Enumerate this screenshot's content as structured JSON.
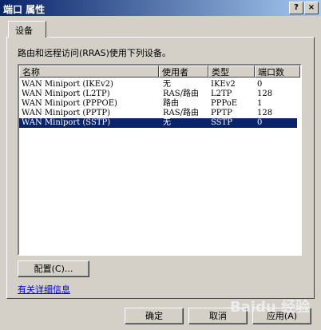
{
  "window": {
    "title": "端口 属性",
    "help_glyph": "?",
    "close_glyph": "×"
  },
  "tab": {
    "label": "设备"
  },
  "description": "路由和远程访问(RRAS)使用下列设备。",
  "table": {
    "columns": [
      "名称",
      "使用者",
      "类型",
      "端口数"
    ],
    "rows": [
      [
        "WAN Miniport (IKEv2)",
        "无",
        "IKEv2",
        "0"
      ],
      [
        "WAN Miniport (L2TP)",
        "RAS/路由",
        "L2TP",
        "128"
      ],
      [
        "WAN Miniport (PPPOE)",
        "路由",
        "PPPoE",
        "1"
      ],
      [
        "WAN Miniport (PPTP)",
        "RAS/路由",
        "PPTP",
        "128"
      ],
      [
        "WAN Miniport (SSTP)",
        "无",
        "SSTP",
        "0"
      ]
    ]
  },
  "buttons": {
    "configure": "配置(C)...",
    "ok": "确定",
    "cancel": "取消",
    "apply": "应用(A)"
  },
  "link": "有关详细信息",
  "watermark": "Baidu 经验"
}
